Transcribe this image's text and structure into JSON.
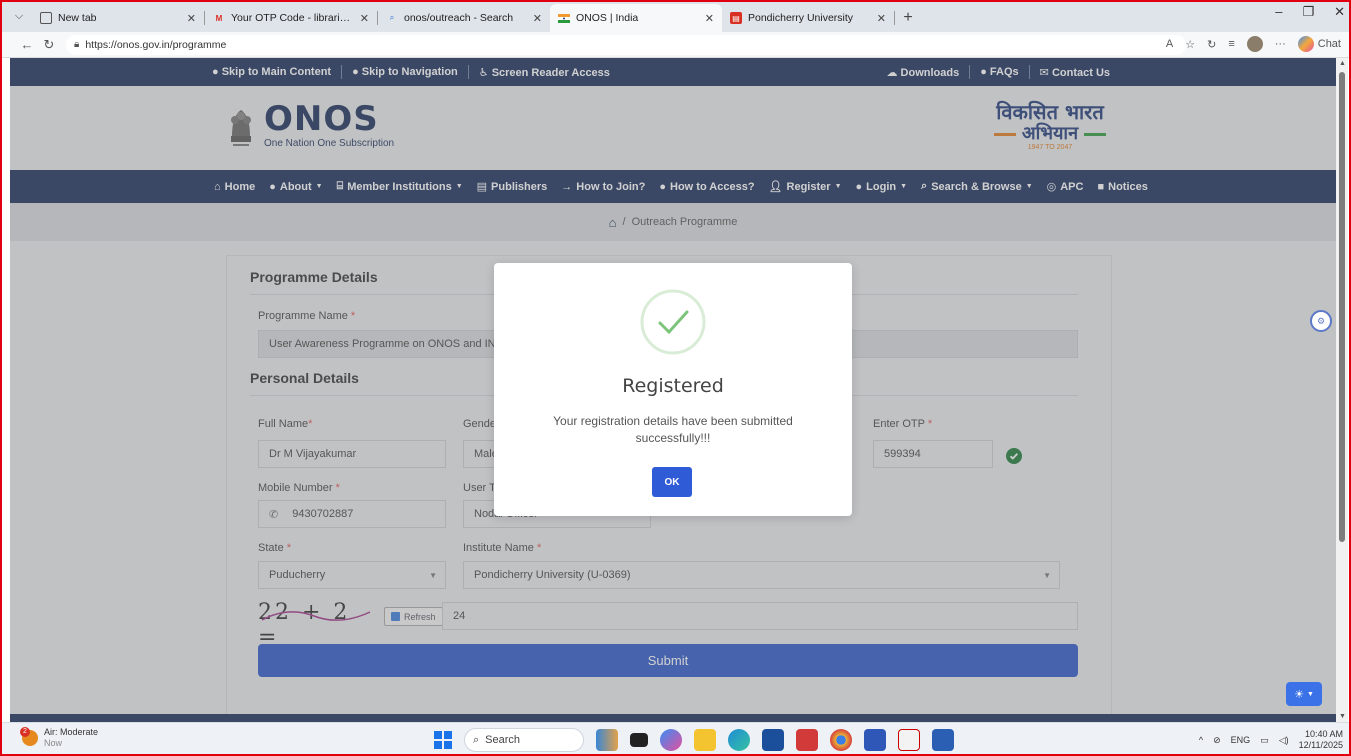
{
  "browser": {
    "tabs": [
      {
        "title": "New tab",
        "icon": "newtab-icon",
        "active": false
      },
      {
        "title": "Your OTP Code - librarian@pondic",
        "icon": "gmail-icon",
        "active": false
      },
      {
        "title": "onos/outreach - Search",
        "icon": "search-icon",
        "active": false
      },
      {
        "title": "ONOS | India",
        "icon": "india-flag-icon",
        "active": true
      },
      {
        "title": "Pondicherry University",
        "icon": "pdf-icon",
        "active": false
      }
    ],
    "url": "https://onos.gov.in/programme",
    "chat_label": "Chat"
  },
  "topbar": {
    "skip_main": "Skip to Main Content",
    "skip_nav": "Skip to Navigation",
    "screen_reader": "Screen Reader Access",
    "downloads": "Downloads",
    "faqs": "FAQs",
    "contact": "Contact Us"
  },
  "logo": {
    "title": "ONOS",
    "subtitle": "One Nation One Subscription",
    "vb_line1": "विकसित भारत",
    "vb_line2": "अभियान",
    "vb_line3": "1947 TO 2047"
  },
  "nav": [
    {
      "label": "Home",
      "icon": "home-icon",
      "dropdown": false
    },
    {
      "label": "About",
      "icon": "info-icon",
      "dropdown": true
    },
    {
      "label": "Member Institutions",
      "icon": "institution-icon",
      "dropdown": true
    },
    {
      "label": "Publishers",
      "icon": "book-icon",
      "dropdown": false
    },
    {
      "label": "How to Join?",
      "icon": "signin-icon",
      "dropdown": false
    },
    {
      "label": "How to Access?",
      "icon": "question-icon",
      "dropdown": false
    },
    {
      "label": "Register",
      "icon": "user-plus-icon",
      "dropdown": true
    },
    {
      "label": "Login",
      "icon": "login-icon",
      "dropdown": true
    },
    {
      "label": "Search & Browse",
      "icon": "search-icon",
      "dropdown": true
    },
    {
      "label": "APC",
      "icon": "apc-icon",
      "dropdown": false
    },
    {
      "label": "Notices",
      "icon": "notice-icon",
      "dropdown": false
    }
  ],
  "breadcrumb": {
    "separator": "/",
    "current": "Outreach Programme"
  },
  "form": {
    "programme_section": "Programme Details",
    "programme_name_label": "Programme Name",
    "programme_name_value": "User Awareness Programme on ONOS and INI",
    "personal_section": "Personal Details",
    "full_name_label": "Full Name",
    "full_name_value": "Dr M Vijayakumar",
    "gender_label": "Gende",
    "gender_value": "Male",
    "otp_label": "Enter OTP",
    "otp_value": "599394",
    "mobile_label": "Mobile Number",
    "mobile_value": "9430702887",
    "user_type_label": "User Ty",
    "user_type_value": "Nodal Officer",
    "state_label": "State",
    "state_value": "Puducherry",
    "institute_label": "Institute Name",
    "institute_value": "Pondicherry University (U-0369)",
    "captcha_text": "22 + 2 =",
    "refresh_label": "Refresh",
    "captcha_answer": "24",
    "submit_label": "Submit",
    "required_mark": "*"
  },
  "modal": {
    "title": "Registered",
    "message": "Your registration details have been submitted successfully!!!",
    "ok_label": "OK"
  },
  "taskbar": {
    "weather_title": "Air: Moderate",
    "weather_sub": "Now",
    "weather_badge": "2",
    "search_label": "Search",
    "lang": "ENG",
    "time": "10:40 AM",
    "date": "12/11/2025"
  },
  "colors": {
    "navy": "#1a2f5c",
    "primary": "#2d58c9",
    "success": "#7cc47a",
    "frame": "#e0000f"
  }
}
